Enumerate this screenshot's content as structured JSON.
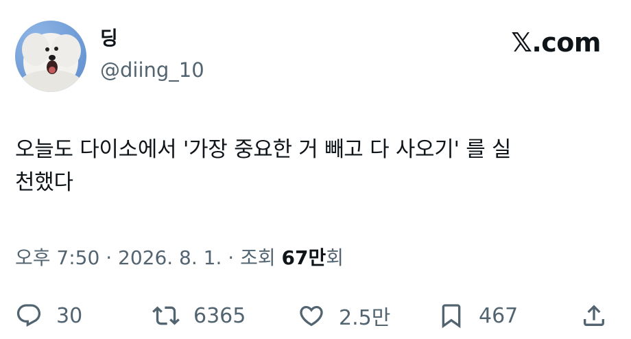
{
  "user": {
    "display_name": "딩",
    "handle": "@diing_10"
  },
  "brand": "𝕏.com",
  "tweet": {
    "text": "오늘도 다이소에서 '가장 중요한 거 빼고 다 사오기' 를 실\n천했다"
  },
  "meta": {
    "time": "오후 7:50 · 2026. 8. 1. · 조회 ",
    "views": "67만",
    "views_suffix": "회"
  },
  "actions": {
    "reply_count": "30",
    "retweet_count": "6365",
    "like_count": "2.5만",
    "bookmark_count": "467"
  },
  "icons": {
    "reply": "reply-icon",
    "retweet": "retweet-icon",
    "like": "heart-icon",
    "bookmark": "bookmark-icon",
    "share": "share-icon"
  },
  "colors": {
    "text": "#0f1419",
    "secondary": "#536471",
    "background": "#ffffff"
  }
}
